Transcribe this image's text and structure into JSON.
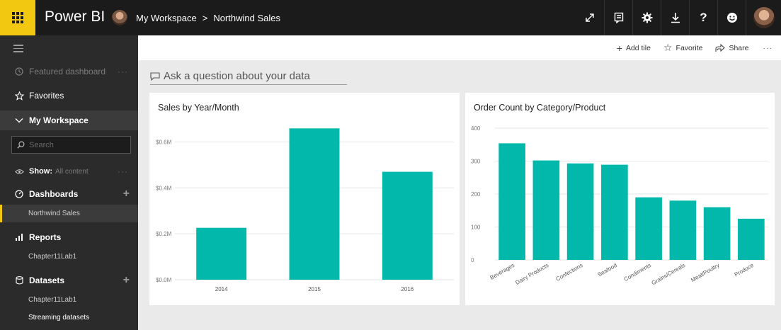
{
  "topbar": {
    "app_name": "Power BI",
    "breadcrumb": [
      "My Workspace",
      "Northwind Sales"
    ],
    "breadcrumb_separator": ">",
    "icons": [
      "expand-icon",
      "notes-icon",
      "settings-icon",
      "download-icon",
      "help-icon",
      "feedback-smiley-icon",
      "user-avatar"
    ],
    "help_glyph": "?"
  },
  "sidebar": {
    "featured": "Featured dashboard",
    "favorites": "Favorites",
    "workspace": "My Workspace",
    "search_placeholder": "Search",
    "show_label": "Show:",
    "show_value": "All content",
    "dashboards": {
      "label": "Dashboards",
      "items": [
        "Northwind Sales"
      ]
    },
    "reports": {
      "label": "Reports",
      "items": [
        "Chapter11Lab1"
      ]
    },
    "datasets": {
      "label": "Datasets",
      "items": [
        "Chapter11Lab1",
        "Streaming datasets"
      ]
    }
  },
  "header": {
    "add_tile": "Add tile",
    "favorite": "Favorite",
    "share": "Share",
    "more": "···"
  },
  "qna": {
    "placeholder": "Ask a question about your data"
  },
  "colors": {
    "accent": "#f2c811",
    "bar": "#01b8aa",
    "topbar": "#1b1b1b",
    "sidebar": "#2b2b2b"
  },
  "chart_data": [
    {
      "type": "bar",
      "title": "Sales by Year/Month",
      "categories": [
        "2014",
        "2015",
        "2016"
      ],
      "values": [
        0.226,
        0.659,
        0.47
      ],
      "yticks": [
        "$0.0M",
        "$0.2M",
        "$0.4M",
        "$0.6M"
      ],
      "ytick_values": [
        0,
        0.2,
        0.4,
        0.6
      ],
      "ylim": [
        0,
        0.7
      ],
      "grid": true
    },
    {
      "type": "bar",
      "title": "Order Count by Category/Product",
      "categories": [
        "Beverages",
        "Dairy Products",
        "Confections",
        "Seafood",
        "Condiments",
        "Grains/Cereals",
        "Meat/Poultry",
        "Produce"
      ],
      "values": [
        354,
        302,
        293,
        289,
        190,
        180,
        160,
        125
      ],
      "yticks": [
        "0",
        "100",
        "200",
        "300",
        "400"
      ],
      "ytick_values": [
        0,
        100,
        200,
        300,
        400
      ],
      "ylim": [
        0,
        400
      ],
      "grid": true
    }
  ]
}
